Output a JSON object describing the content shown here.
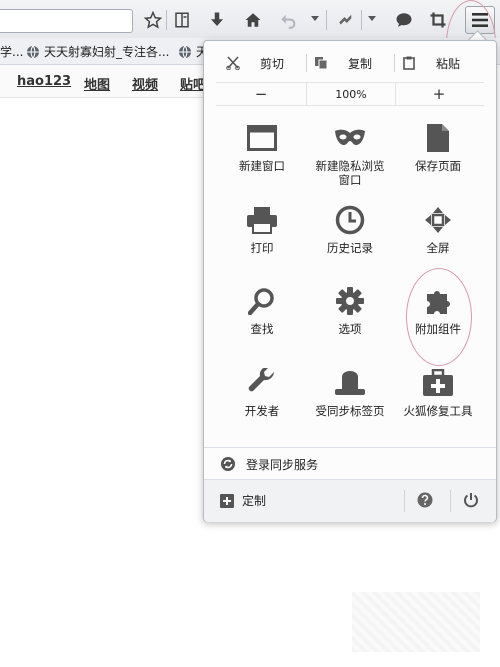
{
  "bookmarks": {
    "items": [
      {
        "label": "天天射寡妇射_专注各..."
      },
      {
        "label": "天"
      }
    ],
    "left_fragment": "学..."
  },
  "nav_links": [
    "hao123",
    "地图",
    "视频",
    "贴吧"
  ],
  "panel": {
    "edit": {
      "cut": "剪切",
      "copy": "复制",
      "paste": "粘贴"
    },
    "zoom": {
      "minus": "−",
      "value": "100%",
      "plus": "+"
    },
    "grid": [
      {
        "label": "新建窗口",
        "icon": "window-icon"
      },
      {
        "label": "新建隐私浏览窗口",
        "icon": "mask-icon"
      },
      {
        "label": "保存页面",
        "icon": "page-icon"
      },
      {
        "label": "打印",
        "icon": "printer-icon"
      },
      {
        "label": "历史记录",
        "icon": "clock-icon"
      },
      {
        "label": "全屏",
        "icon": "fullscreen-icon"
      },
      {
        "label": "查找",
        "icon": "magnifier-icon"
      },
      {
        "label": "选项",
        "icon": "gear-icon"
      },
      {
        "label": "附加组件",
        "icon": "puzzle-icon"
      },
      {
        "label": "开发者",
        "icon": "wrench-icon"
      },
      {
        "label": "受同步标签页",
        "icon": "hat-icon"
      },
      {
        "label": "火狐修复工具",
        "icon": "medkit-icon"
      }
    ],
    "sync_label": "登录同步服务",
    "customize_label": "定制"
  },
  "colors": {
    "annotation": "#d99aa5",
    "icon": "#555555"
  }
}
